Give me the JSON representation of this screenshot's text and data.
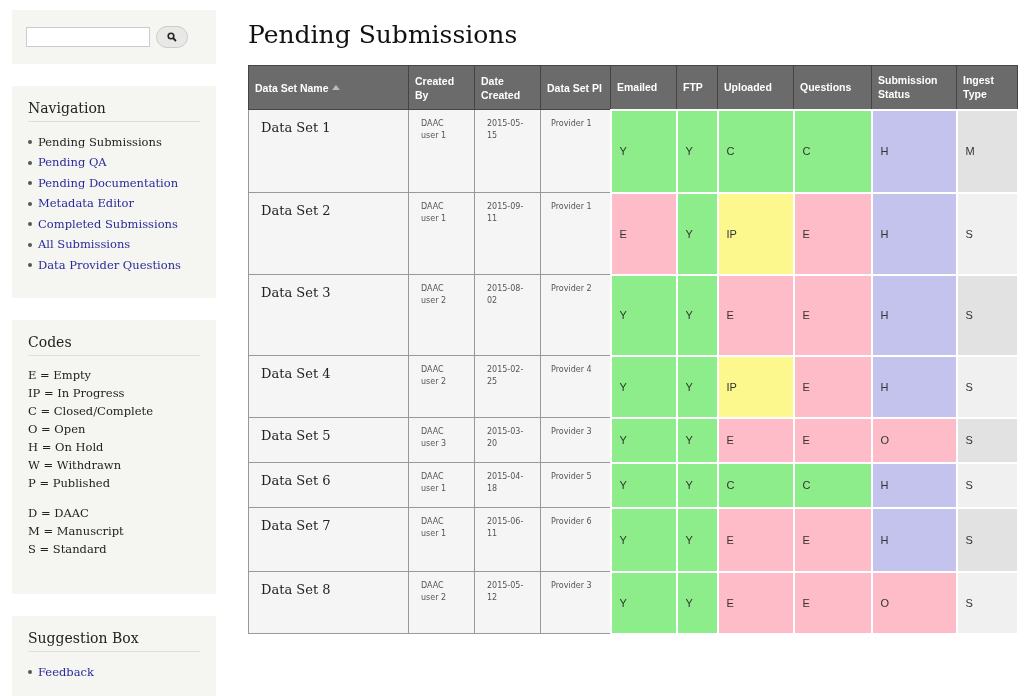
{
  "navigation": {
    "title": "Navigation",
    "items": [
      {
        "label": "Pending Submissions",
        "selected": true
      },
      {
        "label": "Pending QA",
        "selected": false
      },
      {
        "label": "Pending Documentation",
        "selected": false
      },
      {
        "label": "Metadata Editor",
        "selected": false
      },
      {
        "label": "Completed Submissions",
        "selected": false
      },
      {
        "label": "All Submissions",
        "selected": false
      },
      {
        "label": "Data Provider Questions",
        "selected": false
      }
    ]
  },
  "codes": {
    "title": "Codes",
    "groups": [
      [
        "E = Empty",
        "IP = In Progress",
        "C = Closed/Complete",
        "O = Open",
        "H = On Hold",
        "W = Withdrawn",
        "P = Published"
      ],
      [
        "D = DAAC",
        "M = Manuscript",
        "S = Standard"
      ]
    ]
  },
  "suggestion_box": {
    "title": "Suggestion Box",
    "items": [
      "Feedback"
    ]
  },
  "page_title": "Pending Submissions",
  "table": {
    "columns": [
      "Data Set Name",
      "Created By",
      "Date Created",
      "Data Set PI",
      "Emailed",
      "FTP",
      "Uploaded",
      "Questions",
      "Submission Status",
      "Ingest Type"
    ],
    "rows": [
      {
        "name": "Data Set 1",
        "created_by": "DAAC user 1",
        "date_created": "2015-05-15",
        "pi": "Provider 1",
        "status": [
          {
            "text": "Y",
            "color": "#8ded8a"
          },
          {
            "text": "Y",
            "color": "#8ded8a"
          },
          {
            "text": "C",
            "color": "#8ded8a"
          },
          {
            "text": "C",
            "color": "#8ded8a"
          },
          {
            "text": "H",
            "color": "#c3c3ed"
          }
        ],
        "ingest_type": "M"
      },
      {
        "name": "Data Set 2",
        "created_by": "DAAC user 1",
        "date_created": "2015-09-11",
        "pi": "Provider 1",
        "status": [
          {
            "text": "E",
            "color": "#fdbcc8"
          },
          {
            "text": "Y",
            "color": "#8ded8a"
          },
          {
            "text": "IP",
            "color": "#fdf88e"
          },
          {
            "text": "E",
            "color": "#fdbcc8"
          },
          {
            "text": "H",
            "color": "#c3c3ed"
          }
        ],
        "ingest_type": "S"
      },
      {
        "name": "Data Set 3",
        "created_by": "DAAC user 2",
        "date_created": "2015-08-02",
        "pi": "Provider 2",
        "status": [
          {
            "text": "Y",
            "color": "#8ded8a"
          },
          {
            "text": "Y",
            "color": "#8ded8a"
          },
          {
            "text": "E",
            "color": "#fdbcc8"
          },
          {
            "text": "E",
            "color": "#fdbcc8"
          },
          {
            "text": "H",
            "color": "#c3c3ed"
          }
        ],
        "ingest_type": "S"
      },
      {
        "name": "Data Set 4",
        "created_by": "DAAC user 2",
        "date_created": "2015-02-25",
        "pi": "Provider 4",
        "status": [
          {
            "text": "Y",
            "color": "#8ded8a"
          },
          {
            "text": "Y",
            "color": "#8ded8a"
          },
          {
            "text": "IP",
            "color": "#fdf88e"
          },
          {
            "text": "E",
            "color": "#fdbcc8"
          },
          {
            "text": "H",
            "color": "#c3c3ed"
          }
        ],
        "ingest_type": "S"
      },
      {
        "name": "Data Set 5",
        "created_by": "DAAC user 3",
        "date_created": "2015-03-20",
        "pi": "Provider 3",
        "status": [
          {
            "text": "Y",
            "color": "#8ded8a"
          },
          {
            "text": "Y",
            "color": "#8ded8a"
          },
          {
            "text": "E",
            "color": "#fdbcc8"
          },
          {
            "text": "E",
            "color": "#fdbcc8"
          },
          {
            "text": "O",
            "color": "#fdbcc8"
          }
        ],
        "ingest_type": "S"
      },
      {
        "name": "Data Set 6",
        "created_by": "DAAC user 1",
        "date_created": "2015-04-18",
        "pi": "Provider 5",
        "status": [
          {
            "text": "Y",
            "color": "#8ded8a"
          },
          {
            "text": "Y",
            "color": "#8ded8a"
          },
          {
            "text": "C",
            "color": "#8ded8a"
          },
          {
            "text": "C",
            "color": "#8ded8a"
          },
          {
            "text": "H",
            "color": "#c3c3ed"
          }
        ],
        "ingest_type": "S"
      },
      {
        "name": "Data Set 7",
        "created_by": "DAAC user 1",
        "date_created": "2015-06-11",
        "pi": "Provider 6",
        "status": [
          {
            "text": "Y",
            "color": "#8ded8a"
          },
          {
            "text": "Y",
            "color": "#8ded8a"
          },
          {
            "text": "E",
            "color": "#fdbcc8"
          },
          {
            "text": "E",
            "color": "#fdbcc8"
          },
          {
            "text": "H",
            "color": "#c3c3ed"
          }
        ],
        "ingest_type": "S"
      },
      {
        "name": "Data Set 8",
        "created_by": "DAAC user 2",
        "date_created": "2015-05-12",
        "pi": "Provider 3",
        "status": [
          {
            "text": "Y",
            "color": "#8ded8a"
          },
          {
            "text": "Y",
            "color": "#8ded8a"
          },
          {
            "text": "E",
            "color": "#fdbcc8"
          },
          {
            "text": "E",
            "color": "#fdbcc8"
          },
          {
            "text": "O",
            "color": "#fdbcc8"
          }
        ],
        "ingest_type": "S"
      }
    ]
  }
}
